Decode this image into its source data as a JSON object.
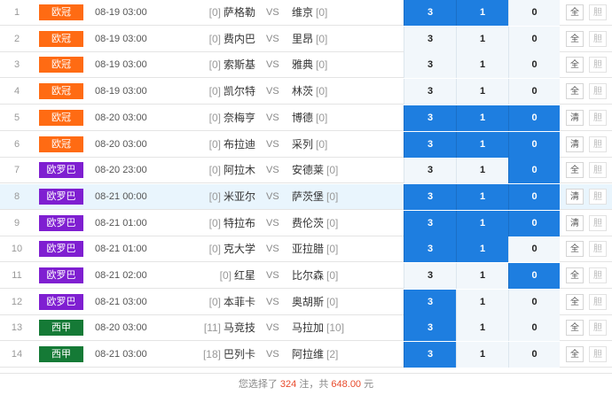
{
  "colors": {
    "league_ucl": "#ff6b13",
    "league_uel": "#7f1fd1",
    "league_laliga": "#157a36",
    "selected": "#1e7ee0",
    "highlight_row": "#e9f5fd",
    "footer_highlight": "#e84b2c"
  },
  "options_labels": [
    "3",
    "1",
    "0"
  ],
  "buttons": {
    "all": "全",
    "clear": "清",
    "dan": "胆"
  },
  "matches": [
    {
      "num": "1",
      "league": "欧冠",
      "league_color": "#ff6b13",
      "time": "08-19 03:00",
      "home_rank": "[0]",
      "home": "萨格勒",
      "vs": "VS",
      "away": "维京",
      "away_rank": "[0]",
      "sel": [
        true,
        true,
        false
      ],
      "all_label": "全",
      "dan_label": "胆",
      "highlight": false
    },
    {
      "num": "2",
      "league": "欧冠",
      "league_color": "#ff6b13",
      "time": "08-19 03:00",
      "home_rank": "[0]",
      "home": "费内巴",
      "vs": "VS",
      "away": "里昂",
      "away_rank": "[0]",
      "sel": [
        false,
        false,
        false
      ],
      "all_label": "全",
      "dan_label": "胆",
      "highlight": false
    },
    {
      "num": "3",
      "league": "欧冠",
      "league_color": "#ff6b13",
      "time": "08-19 03:00",
      "home_rank": "[0]",
      "home": "索斯基",
      "vs": "VS",
      "away": "雅典",
      "away_rank": "[0]",
      "sel": [
        false,
        false,
        false
      ],
      "all_label": "全",
      "dan_label": "胆",
      "highlight": false
    },
    {
      "num": "4",
      "league": "欧冠",
      "league_color": "#ff6b13",
      "time": "08-19 03:00",
      "home_rank": "[0]",
      "home": "凯尔特",
      "vs": "VS",
      "away": "林茨",
      "away_rank": "[0]",
      "sel": [
        false,
        false,
        false
      ],
      "all_label": "全",
      "dan_label": "胆",
      "highlight": false
    },
    {
      "num": "5",
      "league": "欧冠",
      "league_color": "#ff6b13",
      "time": "08-20 03:00",
      "home_rank": "[0]",
      "home": "奈梅亨",
      "vs": "VS",
      "away": "博德",
      "away_rank": "[0]",
      "sel": [
        true,
        true,
        true
      ],
      "all_label": "清",
      "dan_label": "胆",
      "highlight": false
    },
    {
      "num": "6",
      "league": "欧冠",
      "league_color": "#ff6b13",
      "time": "08-20 03:00",
      "home_rank": "[0]",
      "home": "布拉迪",
      "vs": "VS",
      "away": "采列",
      "away_rank": "[0]",
      "sel": [
        true,
        true,
        true
      ],
      "all_label": "清",
      "dan_label": "胆",
      "highlight": false
    },
    {
      "num": "7",
      "league": "欧罗巴",
      "league_color": "#7f1fd1",
      "time": "08-20 23:00",
      "home_rank": "[0]",
      "home": "阿拉木",
      "vs": "VS",
      "away": "安德莱",
      "away_rank": "[0]",
      "sel": [
        false,
        false,
        true
      ],
      "all_label": "全",
      "dan_label": "胆",
      "highlight": false
    },
    {
      "num": "8",
      "league": "欧罗巴",
      "league_color": "#7f1fd1",
      "time": "08-21 00:00",
      "home_rank": "[0]",
      "home": "米亚尔",
      "vs": "VS",
      "away": "萨茨堡",
      "away_rank": "[0]",
      "sel": [
        true,
        true,
        true
      ],
      "all_label": "清",
      "dan_label": "胆",
      "highlight": true
    },
    {
      "num": "9",
      "league": "欧罗巴",
      "league_color": "#7f1fd1",
      "time": "08-21 01:00",
      "home_rank": "[0]",
      "home": "特拉布",
      "vs": "VS",
      "away": "费伦茨",
      "away_rank": "[0]",
      "sel": [
        true,
        true,
        true
      ],
      "all_label": "清",
      "dan_label": "胆",
      "highlight": false
    },
    {
      "num": "10",
      "league": "欧罗巴",
      "league_color": "#7f1fd1",
      "time": "08-21 01:00",
      "home_rank": "[0]",
      "home": "克大学",
      "vs": "VS",
      "away": "亚拉腊",
      "away_rank": "[0]",
      "sel": [
        true,
        true,
        false
      ],
      "all_label": "全",
      "dan_label": "胆",
      "highlight": false
    },
    {
      "num": "11",
      "league": "欧罗巴",
      "league_color": "#7f1fd1",
      "time": "08-21 02:00",
      "home_rank": "[0]",
      "home": "红星",
      "vs": "VS",
      "away": "比尔森",
      "away_rank": "[0]",
      "sel": [
        false,
        false,
        true
      ],
      "all_label": "全",
      "dan_label": "胆",
      "highlight": false
    },
    {
      "num": "12",
      "league": "欧罗巴",
      "league_color": "#7f1fd1",
      "time": "08-21 03:00",
      "home_rank": "[0]",
      "home": "本菲卡",
      "vs": "VS",
      "away": "奥胡斯",
      "away_rank": "[0]",
      "sel": [
        true,
        false,
        false
      ],
      "all_label": "全",
      "dan_label": "胆",
      "highlight": false
    },
    {
      "num": "13",
      "league": "西甲",
      "league_color": "#157a36",
      "time": "08-20 03:00",
      "home_rank": "[11]",
      "home": "马竞技",
      "vs": "VS",
      "away": "马拉加",
      "away_rank": "[10]",
      "sel": [
        true,
        false,
        false
      ],
      "all_label": "全",
      "dan_label": "胆",
      "highlight": false
    },
    {
      "num": "14",
      "league": "西甲",
      "league_color": "#157a36",
      "time": "08-21 03:00",
      "home_rank": "[18]",
      "home": "巴列卡",
      "vs": "VS",
      "away": "阿拉维",
      "away_rank": "[2]",
      "sel": [
        true,
        false,
        false
      ],
      "all_label": "全",
      "dan_label": "胆",
      "highlight": false
    }
  ],
  "footer": {
    "prefix": "您选择了",
    "count": "324",
    "mid": "注，共",
    "amount": "648.00",
    "suffix": "元"
  }
}
